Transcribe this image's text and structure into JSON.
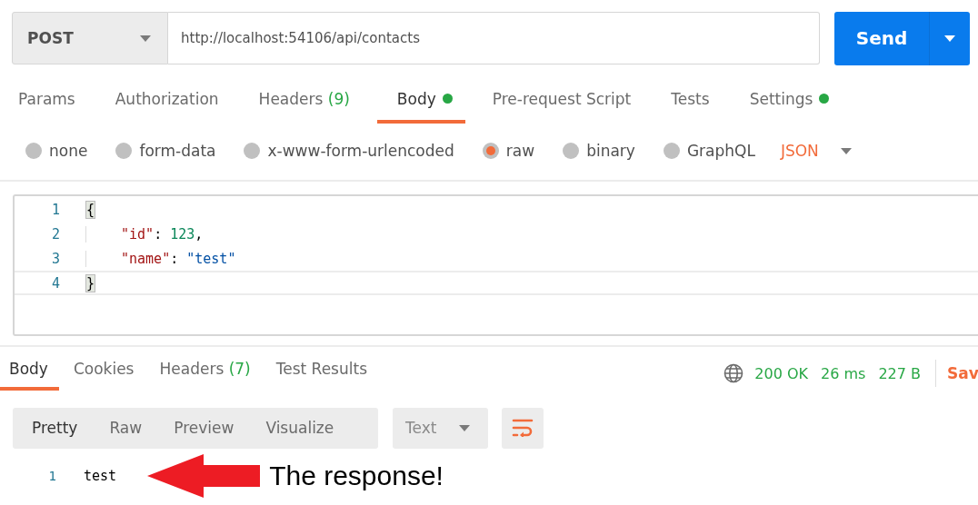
{
  "request": {
    "method": "POST",
    "url": "http://localhost:54106/api/contacts",
    "send": "Send"
  },
  "request_tabs": [
    {
      "label": "Params",
      "selected": false,
      "dot": false
    },
    {
      "label": "Authorization",
      "selected": false,
      "dot": false
    },
    {
      "label": "Headers",
      "count": "(9)",
      "selected": false,
      "dot": false
    },
    {
      "label": "Body",
      "selected": true,
      "dot": true
    },
    {
      "label": "Pre-request Script",
      "selected": false,
      "dot": false
    },
    {
      "label": "Tests",
      "selected": false,
      "dot": false
    },
    {
      "label": "Settings",
      "selected": false,
      "dot": true
    }
  ],
  "body_types": [
    {
      "label": "none",
      "selected": false
    },
    {
      "label": "form-data",
      "selected": false
    },
    {
      "label": "x-www-form-urlencoded",
      "selected": false
    },
    {
      "label": "raw",
      "selected": true
    },
    {
      "label": "binary",
      "selected": false
    },
    {
      "label": "GraphQL",
      "selected": false
    }
  ],
  "format": "JSON",
  "editor": {
    "lines": [
      {
        "number": "1",
        "indented": false,
        "active": false,
        "tokens": [
          {
            "kind": "bracket",
            "text": "{"
          }
        ]
      },
      {
        "number": "2",
        "indented": true,
        "active": false,
        "tokens": [
          {
            "kind": "key",
            "text": "\"id\""
          },
          {
            "kind": "punct",
            "text": ": "
          },
          {
            "kind": "number",
            "text": "123"
          },
          {
            "kind": "punct",
            "text": ","
          }
        ]
      },
      {
        "number": "3",
        "indented": true,
        "active": false,
        "tokens": [
          {
            "kind": "key",
            "text": "\"name\""
          },
          {
            "kind": "punct",
            "text": ": "
          },
          {
            "kind": "string",
            "text": "\"test\""
          }
        ]
      },
      {
        "number": "4",
        "indented": false,
        "active": true,
        "tokens": [
          {
            "kind": "bracket",
            "text": "}"
          }
        ]
      }
    ]
  },
  "response_tabs": [
    {
      "label": "Body",
      "selected": true
    },
    {
      "label": "Cookies",
      "selected": false
    },
    {
      "label": "Headers",
      "count": "(7)",
      "selected": false
    },
    {
      "label": "Test Results",
      "selected": false
    }
  ],
  "response_status": {
    "status": "200 OK",
    "time": "26 ms",
    "size": "227 B",
    "save": "Sav"
  },
  "view_modes": [
    {
      "label": "Pretty",
      "selected": true
    },
    {
      "label": "Raw",
      "selected": false
    },
    {
      "label": "Preview",
      "selected": false
    },
    {
      "label": "Visualize",
      "selected": false
    }
  ],
  "response_type": "Text",
  "response_lines": [
    {
      "number": "1",
      "text": "test"
    }
  ],
  "annotation": {
    "text": "The response!"
  }
}
